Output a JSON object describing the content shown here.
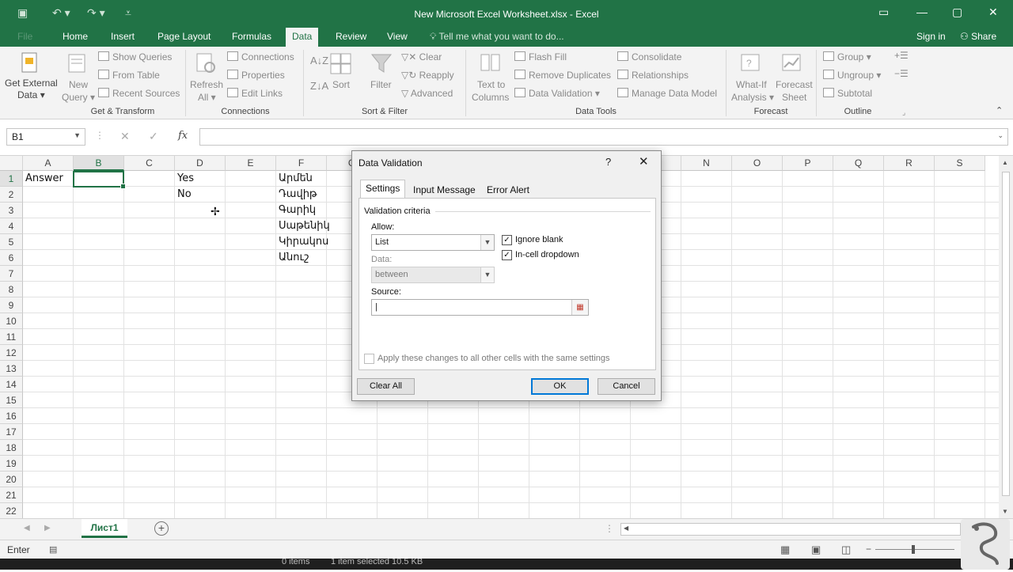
{
  "window": {
    "title": "New Microsoft Excel Worksheet.xlsx - Excel"
  },
  "menu": {
    "tabs": [
      "File",
      "Home",
      "Insert",
      "Page Layout",
      "Formulas",
      "Data",
      "Review",
      "View"
    ],
    "tell_me": "Tell me what you want to do...",
    "sign_in": "Sign in",
    "share": "Share"
  },
  "ribbon": {
    "get_transform": {
      "label": "Get & Transform",
      "get_external_1": "Get External",
      "get_external_2": "Data",
      "new_query_1": "New",
      "new_query_2": "Query",
      "show_queries": "Show Queries",
      "from_table": "From Table",
      "recent_sources": "Recent Sources"
    },
    "connections": {
      "label": "Connections",
      "refresh_1": "Refresh",
      "refresh_2": "All",
      "connections": "Connections",
      "properties": "Properties",
      "edit_links": "Edit Links"
    },
    "sort_filter": {
      "label": "Sort & Filter",
      "sort": "Sort",
      "filter": "Filter",
      "clear": "Clear",
      "reapply": "Reapply",
      "advanced": "Advanced"
    },
    "data_tools": {
      "label": "Data Tools",
      "text_to_1": "Text to",
      "text_to_2": "Columns",
      "flash_fill": "Flash Fill",
      "remove_duplicates": "Remove Duplicates",
      "data_validation": "Data Validation",
      "consolidate": "Consolidate",
      "relationships": "Relationships",
      "manage_data_model": "Manage Data Model"
    },
    "forecast": {
      "label": "Forecast",
      "whatif_1": "What-If",
      "whatif_2": "Analysis",
      "fsheet_1": "Forecast",
      "fsheet_2": "Sheet"
    },
    "outline": {
      "label": "Outline",
      "group": "Group",
      "ungroup": "Ungroup",
      "subtotal": "Subtotal"
    }
  },
  "formula_bar": {
    "name_box": "B1",
    "fx": "fx",
    "value": ""
  },
  "grid": {
    "columns": [
      "A",
      "B",
      "C",
      "D",
      "E",
      "F",
      "G",
      "H",
      "I",
      "J",
      "K",
      "L",
      "M",
      "N",
      "O",
      "P",
      "Q",
      "R",
      "S"
    ],
    "rows": [
      "1",
      "2",
      "3",
      "4",
      "5",
      "6",
      "7",
      "8",
      "9",
      "10",
      "11",
      "12",
      "13",
      "14",
      "15",
      "16",
      "17",
      "18",
      "19",
      "20",
      "21",
      "22"
    ],
    "selected_cell": "B1",
    "cells": {
      "a1": "Answer",
      "d1": "Yes",
      "d2": "No",
      "f1": "Արմեն",
      "f2": "Դավիթ",
      "f3": "Գարիկ",
      "f4": "Սաթենիկ",
      "f5": "Կիրակոս",
      "f6": "Անուշ"
    }
  },
  "sheet_tabs": {
    "active": "Лист1"
  },
  "status": {
    "mode": "Enter",
    "taskbar_items": "0 items",
    "taskbar_selected": "1 item selected  10.5 KB"
  },
  "dialog": {
    "title": "Data Validation",
    "help": "?",
    "tabs": [
      "Settings",
      "Input Message",
      "Error Alert"
    ],
    "criteria_label": "Validation criteria",
    "allow_label": "Allow:",
    "allow_value": "List",
    "data_label": "Data:",
    "data_value": "between",
    "source_label": "Source:",
    "source_value": "|",
    "ignore_blank": "Ignore blank",
    "incell_dropdown": "In-cell dropdown",
    "apply_all": "Apply these changes to all other cells with the same settings",
    "clear_all": "Clear All",
    "ok": "OK",
    "cancel": "Cancel"
  },
  "colors": {
    "accent": "#217346",
    "focus": "#0078d7"
  }
}
